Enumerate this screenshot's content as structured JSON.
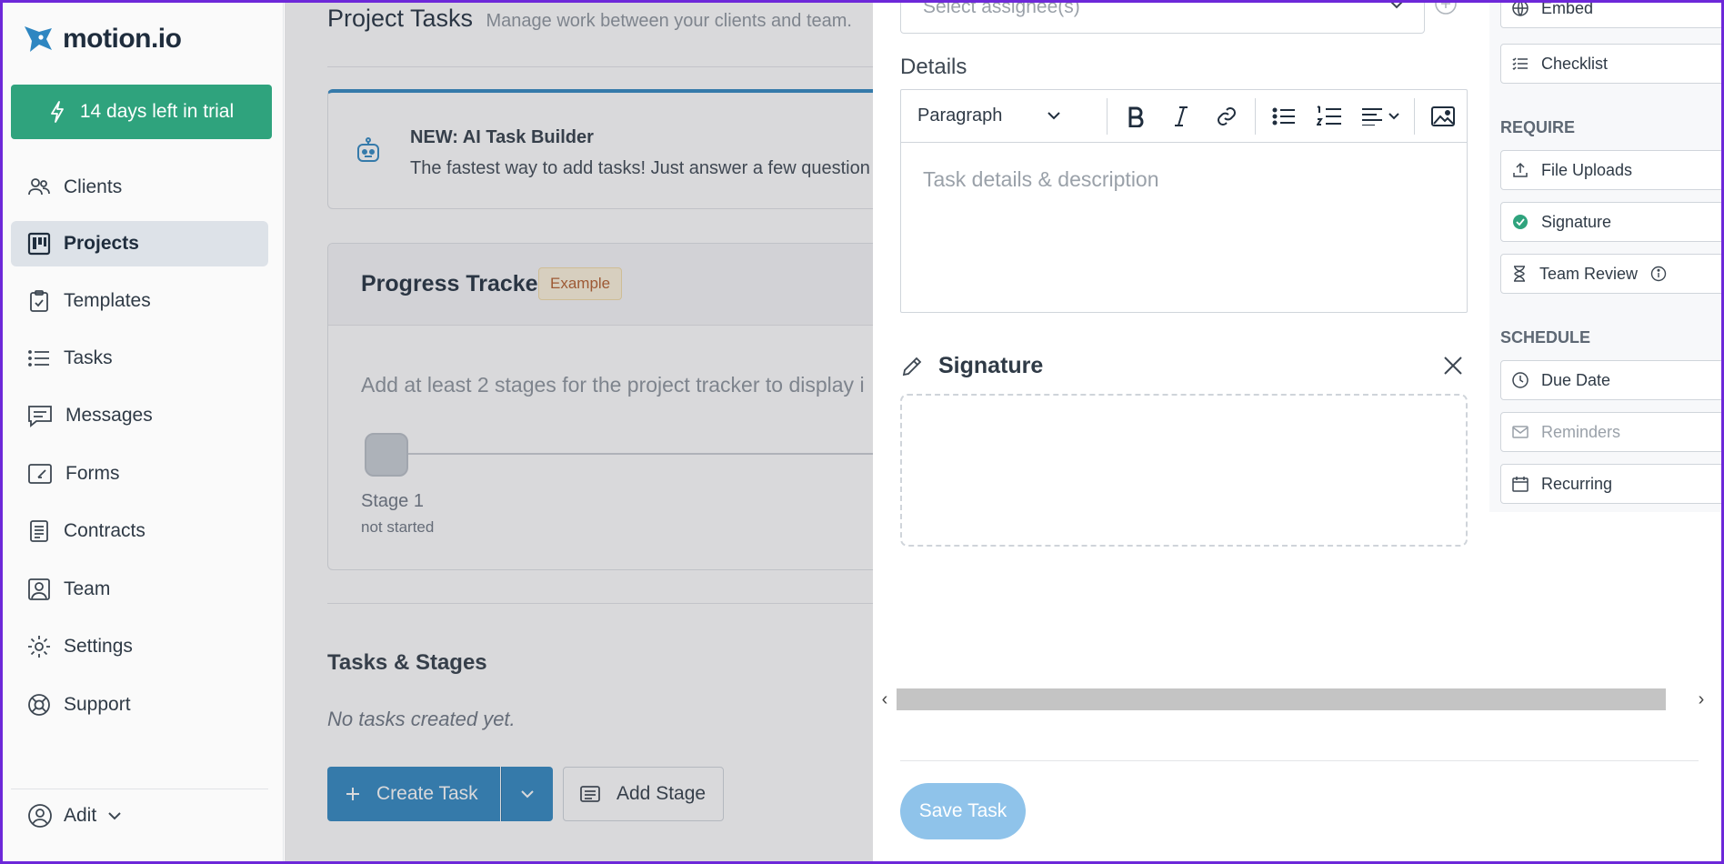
{
  "app": {
    "brand": "motion.io",
    "accent": "#2e86c1",
    "trial_color": "#2fa37d"
  },
  "sidebar": {
    "trial_banner": "14 days left in trial",
    "items": [
      {
        "label": "Clients",
        "icon": "users-icon"
      },
      {
        "label": "Projects",
        "icon": "kanban-icon",
        "active": true
      },
      {
        "label": "Templates",
        "icon": "clipboard-check-icon"
      },
      {
        "label": "Tasks",
        "icon": "list-icon"
      },
      {
        "label": "Messages",
        "icon": "message-icon"
      },
      {
        "label": "Forms",
        "icon": "form-icon"
      },
      {
        "label": "Contracts",
        "icon": "document-icon"
      },
      {
        "label": "Team",
        "icon": "team-icon"
      },
      {
        "label": "Settings",
        "icon": "gear-icon"
      },
      {
        "label": "Support",
        "icon": "lifebuoy-icon"
      }
    ],
    "user": {
      "name": "Adit"
    }
  },
  "main": {
    "title": "Project Tasks",
    "subtitle": "Manage work between your clients and team.",
    "ai_card": {
      "title": "NEW: AI Task Builder",
      "description": "The fastest way to add tasks! Just answer a few question"
    },
    "tracker": {
      "title": "Progress Tracker",
      "badge": "Example",
      "hint": "Add at least 2 stages for the project tracker to display i",
      "stage_name": "Stage 1",
      "stage_status": "not started"
    },
    "tasks_heading": "Tasks & Stages",
    "tasks_empty": "No tasks created yet.",
    "create_task": "Create Task",
    "add_stage": "Add Stage"
  },
  "panel": {
    "assignee_placeholder": "Select assignee(s)",
    "details_label": "Details",
    "format_value": "Paragraph",
    "editor_placeholder": "Task details & description",
    "signature_title": "Signature",
    "save_task": "Save Task",
    "side": {
      "top_buttons": [
        "Embed",
        "Checklist"
      ],
      "require_label": "REQUIRE",
      "require": [
        "File Uploads",
        "Signature",
        "Team Review"
      ],
      "schedule_label": "SCHEDULE",
      "schedule": [
        "Due Date",
        "Reminders",
        "Recurring"
      ]
    }
  }
}
